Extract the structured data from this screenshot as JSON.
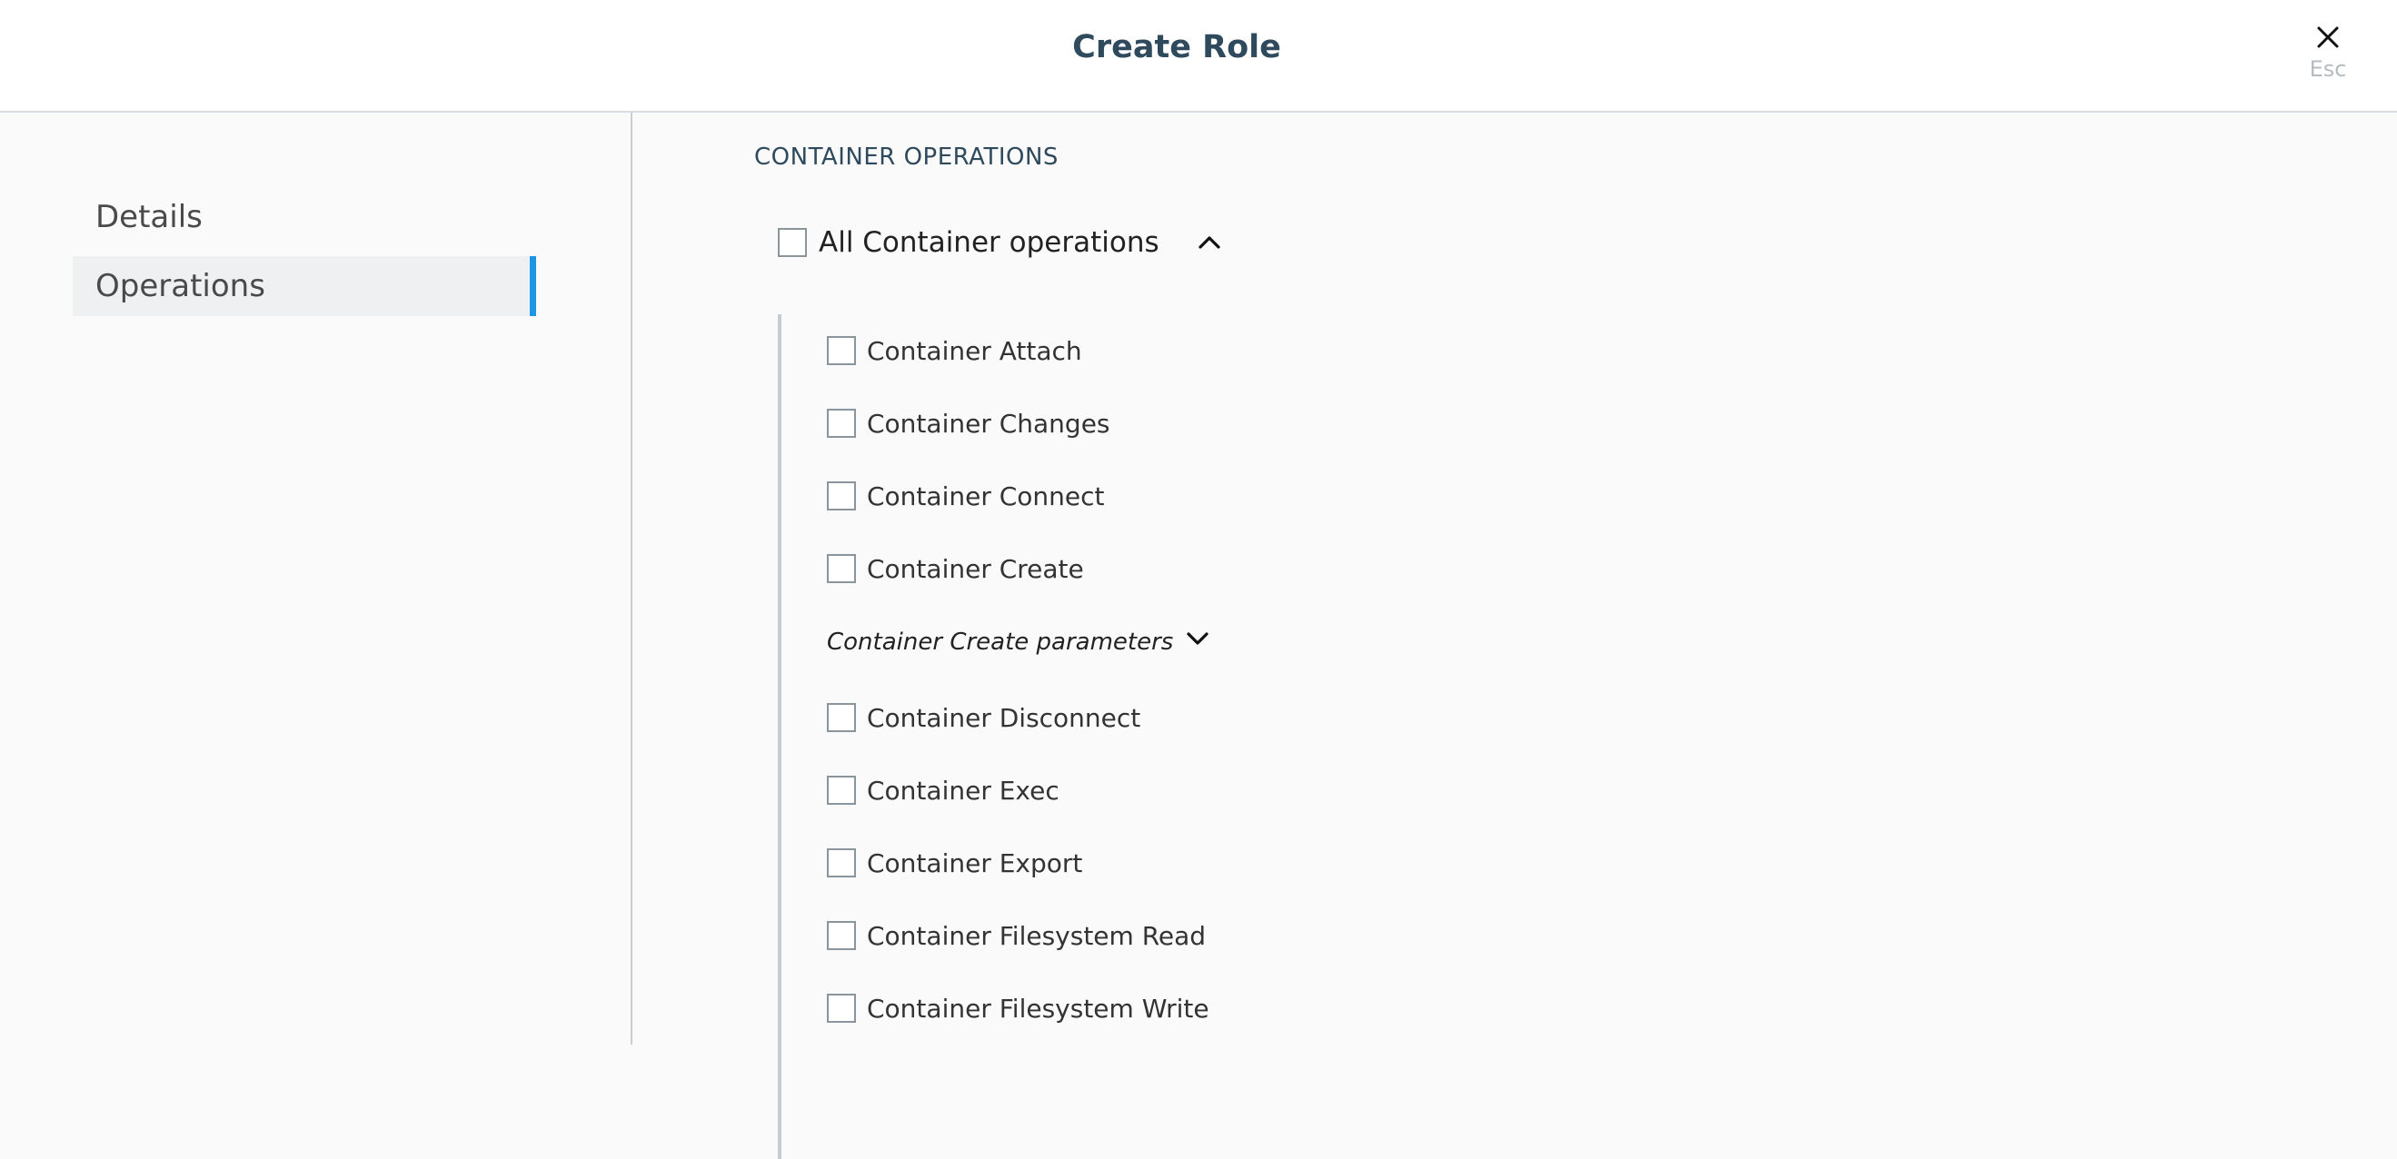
{
  "header": {
    "title": "Create Role",
    "close_hint": "Esc"
  },
  "sidebar": {
    "items": [
      {
        "label": "Details",
        "active": false
      },
      {
        "label": "Operations",
        "active": true
      }
    ]
  },
  "main": {
    "section_heading": "CONTAINER OPERATIONS",
    "group": {
      "label": "All Container operations",
      "checked": false,
      "expanded": true
    },
    "operations_before_params": [
      {
        "label": "Container Attach",
        "checked": false
      },
      {
        "label": "Container Changes",
        "checked": false
      },
      {
        "label": "Container Connect",
        "checked": false
      },
      {
        "label": "Container Create",
        "checked": false
      }
    ],
    "params_toggle": {
      "label": "Container Create parameters",
      "expanded": false
    },
    "operations_after_params": [
      {
        "label": "Container Disconnect",
        "checked": false
      },
      {
        "label": "Container Exec",
        "checked": false
      },
      {
        "label": "Container Export",
        "checked": false
      },
      {
        "label": "Container Filesystem Read",
        "checked": false
      },
      {
        "label": "Container Filesystem Write",
        "checked": false
      }
    ]
  },
  "colors": {
    "accent": "#1e96e6",
    "title_text": "#2e4a5c",
    "background": "#fafafa",
    "active_nav_bg": "#eff0f1",
    "divider": "#c7cfd5"
  },
  "icons": {
    "close": "close-icon",
    "group_toggle": "chevron-up-icon",
    "params_toggle": "chevron-down-icon"
  }
}
